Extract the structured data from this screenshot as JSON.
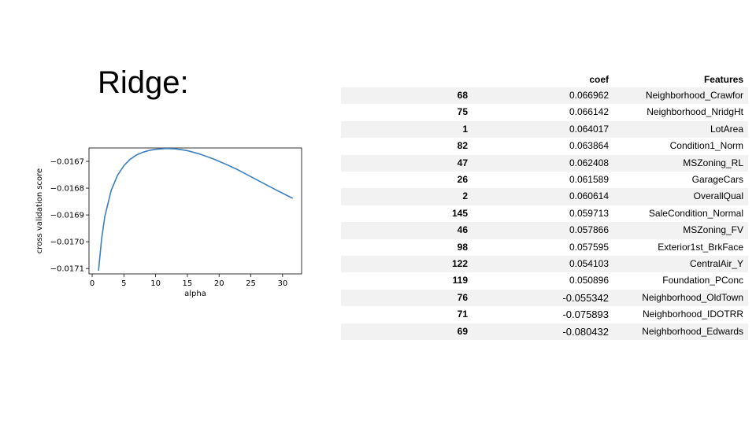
{
  "slide": {
    "title": "Ridge:"
  },
  "chart_data": {
    "type": "line",
    "xlabel": "alpha",
    "ylabel": "cross validation score",
    "xlim": [
      -0.5,
      33
    ],
    "ylim": [
      -0.01712,
      -0.01665
    ],
    "x_ticks": [
      0,
      5,
      10,
      15,
      20,
      25,
      30
    ],
    "x_tick_labels": [
      "0",
      "5",
      "10",
      "15",
      "20",
      "25",
      "30"
    ],
    "y_ticks": [
      -0.0171,
      -0.017,
      -0.0169,
      -0.0168,
      -0.0167
    ],
    "y_tick_labels": [
      "−0.0171",
      "−0.0170",
      "−0.0169",
      "−0.0168",
      "−0.0167"
    ],
    "grid": false,
    "line_color": "#3a7fbf",
    "series": [
      {
        "x": [
          1,
          1.5,
          2,
          3,
          4,
          5,
          6,
          7,
          8,
          9,
          10,
          11,
          11.7,
          13,
          14,
          15,
          17,
          19,
          21,
          23,
          25,
          27,
          29,
          31.6
        ],
        "values": [
          -0.017108,
          -0.016987,
          -0.016905,
          -0.016808,
          -0.016752,
          -0.016716,
          -0.016692,
          -0.016676,
          -0.016666,
          -0.016659,
          -0.016655,
          -0.016653,
          -0.016652,
          -0.016653,
          -0.016656,
          -0.01666,
          -0.016673,
          -0.01669,
          -0.01671,
          -0.016732,
          -0.016757,
          -0.016782,
          -0.016807,
          -0.016838
        ]
      }
    ]
  },
  "table": {
    "headers": [
      "",
      "coef",
      "Features"
    ],
    "rows": [
      {
        "index": "68",
        "coef": "0.066962",
        "feature": "Neighborhood_Crawfor"
      },
      {
        "index": "75",
        "coef": "0.066142",
        "feature": "Neighborhood_NridgHt"
      },
      {
        "index": "1",
        "coef": "0.064017",
        "feature": "LotArea"
      },
      {
        "index": "82",
        "coef": "0.063864",
        "feature": "Condition1_Norm"
      },
      {
        "index": "47",
        "coef": "0.062408",
        "feature": "MSZoning_RL"
      },
      {
        "index": "26",
        "coef": "0.061589",
        "feature": "GarageCars"
      },
      {
        "index": "2",
        "coef": "0.060614",
        "feature": "OverallQual"
      },
      {
        "index": "145",
        "coef": "0.059713",
        "feature": "SaleCondition_Normal"
      },
      {
        "index": "46",
        "coef": "0.057866",
        "feature": "MSZoning_FV"
      },
      {
        "index": "98",
        "coef": "0.057595",
        "feature": "Exterior1st_BrkFace"
      },
      {
        "index": "122",
        "coef": "0.054103",
        "feature": "CentralAir_Y"
      },
      {
        "index": "119",
        "coef": "0.050896",
        "feature": "Foundation_PConc"
      },
      {
        "index": "76",
        "coef": "-0.055342",
        "feature": "Neighborhood_OldTown"
      },
      {
        "index": "71",
        "coef": "-0.075893",
        "feature": "Neighborhood_IDOTRR"
      },
      {
        "index": "69",
        "coef": "-0.080432",
        "feature": "Neighborhood_Edwards"
      }
    ]
  }
}
